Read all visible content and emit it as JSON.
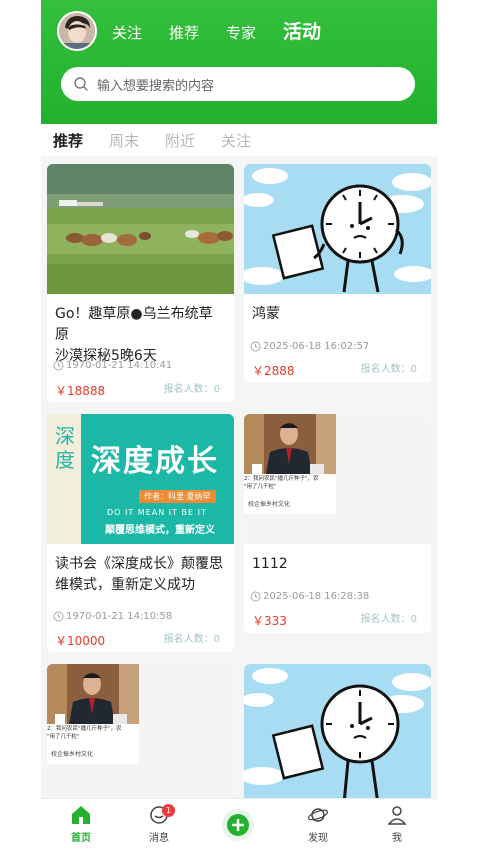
{
  "header": {
    "tabs": [
      "关注",
      "推荐",
      "专家",
      "活动"
    ],
    "active_tab": "活动"
  },
  "search": {
    "placeholder": "输入想要搜索的内容"
  },
  "sub_tabs": [
    "推荐",
    "周末",
    "附近",
    "关注"
  ],
  "cards": [
    {
      "title_line1": "Go！趣草原●乌兰布统草原",
      "title_line2": "沙漠探秘5晚6天",
      "time": "1970-01-21 14:10:41",
      "price": "￥18888",
      "signup": "报名人数：0",
      "image": "grassland-photo"
    },
    {
      "title_line1": "鸿蒙",
      "title_line2": "",
      "time": "2025-06-18 16:02:57",
      "price": "￥2888",
      "signup": "报名人数：0",
      "image": "clock-cartoon"
    },
    {
      "title_line1": "读书会《深度成长》颠覆思",
      "title_line2": "维模式，重新定义成功",
      "time": "1970-01-21 14:10:58",
      "price": "￥10000",
      "signup": "报名人数：0",
      "image": "book-cover"
    },
    {
      "title_line1": "1112",
      "title_line2": "",
      "time": "2025-06-18 16:28:38",
      "price": "￥333",
      "signup": "报名人数：0",
      "image": "video-thumbnail"
    }
  ],
  "book_cover": {
    "vertical_text": "深度",
    "headline": "深度成长",
    "author": "作者：科里·夏纳罕",
    "english": "DO IT MEAN IT BE IT",
    "slogan": "颠覆思维模式，重新定义"
  },
  "video_thumb": {
    "caption_line1": "2：我问农民\"播几斤种子\"，农",
    "caption_line2": "\"用了几千粒\"",
    "source": "校企振乡村文化"
  },
  "bottom_nav": {
    "home": "首页",
    "messages": "消息",
    "messages_badge": "1",
    "discover": "发现",
    "me": "我"
  },
  "colors": {
    "brand_green": "#24b12f",
    "price_red": "#e8392a",
    "sky_blue": "#a8dcf2"
  }
}
